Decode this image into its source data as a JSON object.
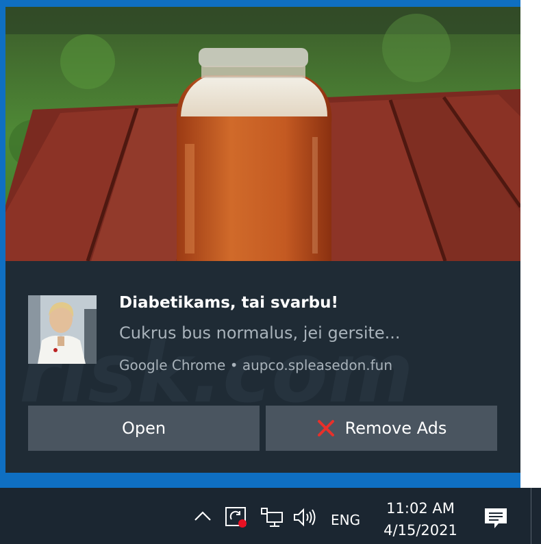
{
  "notification": {
    "title": "Diabetikams, tai svarbu!",
    "body": "Cukrus bus normalus, jei gersite...",
    "source": "Google Chrome • aupco.spleasedon.fun",
    "hero_image": "jar-of-juice-on-wooden-table-photo",
    "thumbnail_image": "woman-doctor-in-white-coat-photo",
    "buttons": {
      "open": "Open",
      "remove_ads": "Remove Ads"
    },
    "remove_icon": "red-x-icon"
  },
  "taskbar": {
    "language": "ENG",
    "time": "11:02 AM",
    "date": "4/15/2021",
    "tray_icons": [
      "chevron-up-icon",
      "sync-alert-icon",
      "network-icon",
      "volume-icon",
      "action-center-icon"
    ]
  },
  "colors": {
    "accent_blue": "#0f6fc2",
    "toast_bg": "#1f2b35",
    "button_bg": "#4a5560",
    "taskbar_bg": "#1b2631",
    "alert_red": "#e81123"
  }
}
